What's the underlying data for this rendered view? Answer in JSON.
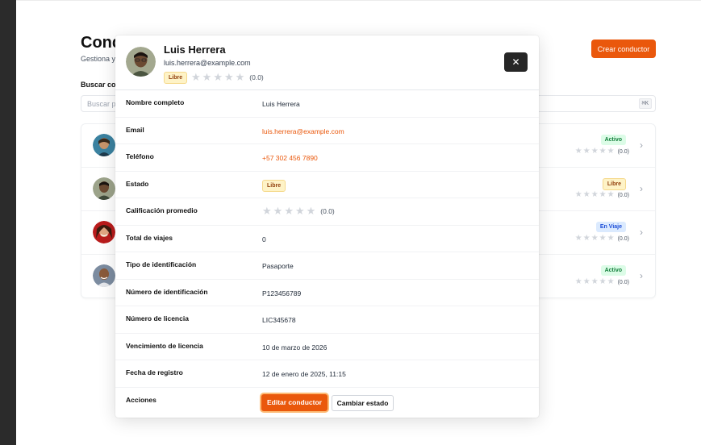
{
  "page": {
    "title": "Conductores",
    "subtitle": "Gestiona y administra los conductores",
    "create_button": "Crear conductor",
    "search_label": "Buscar conductor",
    "search_placeholder": "Buscar por nombre, email o teléfono...",
    "search_shortcut": "⌘K"
  },
  "drivers": [
    {
      "status": "Activo",
      "status_kind": "activo",
      "rating": "(0.0)"
    },
    {
      "status": "Libre",
      "status_kind": "libre",
      "rating": "(0.0)"
    },
    {
      "status": "En Viaje",
      "status_kind": "viaje",
      "rating": "(0.0)"
    },
    {
      "status": "Activo",
      "status_kind": "activo",
      "rating": "(0.0)"
    }
  ],
  "modal": {
    "name": "Luis Herrera",
    "email": "luis.herrera@example.com",
    "status": "Libre",
    "rating": "(0.0)",
    "close_icon": "close-icon",
    "fields": {
      "full_name": {
        "label": "Nombre completo",
        "value": "Luis Herrera"
      },
      "email": {
        "label": "Email",
        "value": "luis.herrera@example.com"
      },
      "phone": {
        "label": "Teléfono",
        "value": "+57 302 456 7890"
      },
      "state": {
        "label": "Estado",
        "value": "Libre"
      },
      "avg_rating": {
        "label": "Calificación promedio",
        "value": "(0.0)"
      },
      "total_trips": {
        "label": "Total de viajes",
        "value": "0"
      },
      "id_type": {
        "label": "Tipo de identificación",
        "value": "Pasaporte"
      },
      "id_number": {
        "label": "Número de identificación",
        "value": "P123456789"
      },
      "license_number": {
        "label": "Número de licencia",
        "value": "LIC345678"
      },
      "license_expiry": {
        "label": "Vencimiento de licencia",
        "value": "10 de marzo de 2026"
      },
      "registered": {
        "label": "Fecha de registro",
        "value": "12 de enero de 2025, 11:15"
      }
    },
    "actions_label": "Acciones",
    "edit_button": "Editar conductor",
    "change_state_button": "Cambiar estado"
  },
  "colors": {
    "accent": "#ea580c",
    "sidebar": "#2b2b2b",
    "close_button": "#262626"
  }
}
